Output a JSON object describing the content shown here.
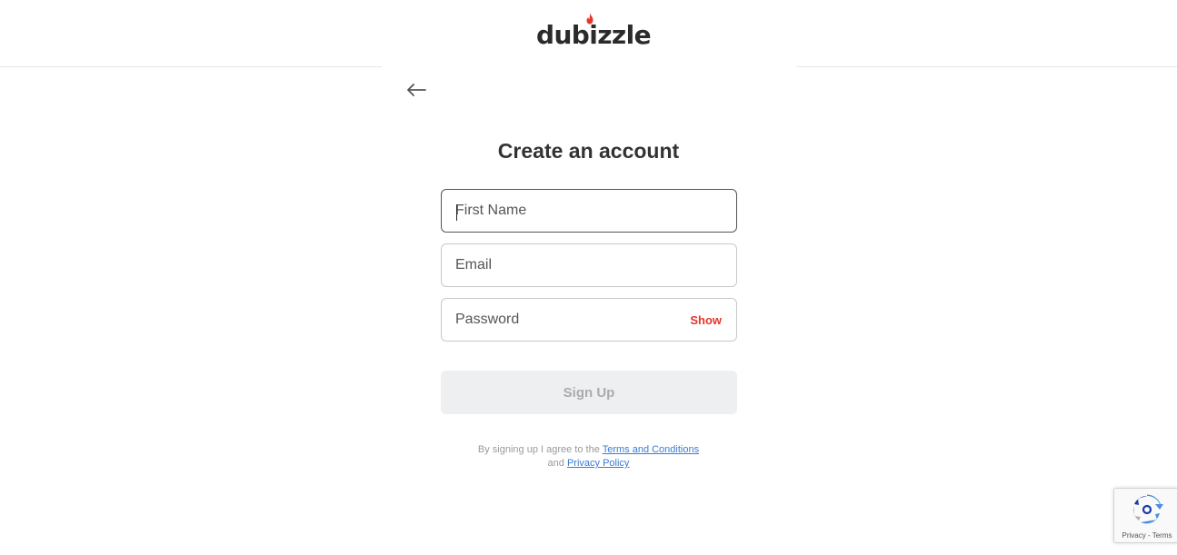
{
  "header": {
    "logo_text": "dubizzle",
    "logo_accent_color": "#e4352b"
  },
  "nav": {
    "back_icon": "arrow-left-icon"
  },
  "form": {
    "title": "Create an account",
    "first_name_placeholder": "First Name",
    "email_placeholder": "Email",
    "password_placeholder": "Password",
    "show_label": "Show",
    "signup_label": "Sign Up",
    "focused_field": "first_name"
  },
  "legal": {
    "prefix": "By signing up I agree to the",
    "terms_link": "Terms and Conditions",
    "conjunction": "and",
    "privacy_link": "Privacy Policy",
    "link_color": "#3a7bd5"
  },
  "recaptcha": {
    "links": "Privacy - Terms",
    "icon": "recaptcha-icon"
  }
}
